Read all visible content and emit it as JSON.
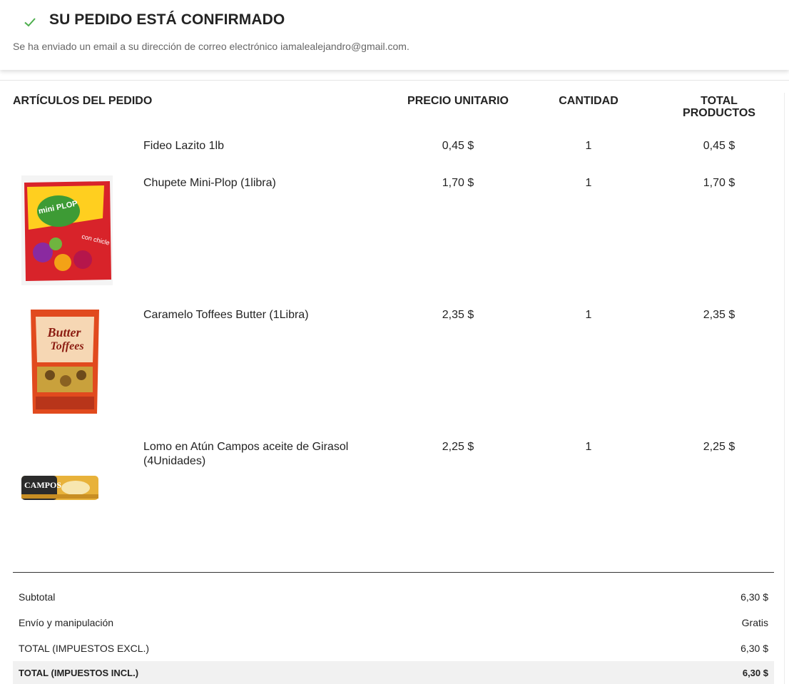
{
  "header": {
    "title": "SU PEDIDO ESTÁ CONFIRMADO",
    "subtitle": "Se ha enviado un email a su dirección de correo electrónico iamalealejandro@gmail.com.",
    "check_color": "#4cae4c"
  },
  "table": {
    "headers": {
      "items": "ARTÍCULOS DEL PEDIDO",
      "unit_price": "PRECIO UNITARIO",
      "quantity": "CANTIDAD",
      "total_line1": "TOTAL",
      "total_line2": "PRODUCTOS"
    },
    "rows": [
      {
        "name": "Fideo Lazito 1lb",
        "price": "0,45 $",
        "qty": "1",
        "total": "0,45 $"
      },
      {
        "name": "Chupete Mini-Plop (1libra)",
        "price": "1,70 $",
        "qty": "1",
        "total": "1,70 $",
        "image": "mini-plop-bag"
      },
      {
        "name": "Caramelo Toffees Butter (1Libra)",
        "price": "2,35 $",
        "qty": "1",
        "total": "2,35 $",
        "image": "butter-toffees-bag"
      },
      {
        "name": "Lomo en Atún Campos aceite de Girasol (4Unidades)",
        "price": "2,25 $",
        "qty": "1",
        "total": "2,25 $",
        "image": "campos-tuna-cans"
      }
    ]
  },
  "summary": {
    "subtotal_label": "Subtotal",
    "subtotal_value": "6,30 $",
    "shipping_label": "Envío y manipulación",
    "shipping_value": "Gratis",
    "total_excl_label": "TOTAL (IMPUESTOS EXCL.)",
    "total_excl_value": "6,30 $",
    "total_incl_label": "TOTAL (IMPUESTOS INCL.)",
    "total_incl_value": "6,30 $"
  },
  "images": {
    "mini_plop_logo": "mini PLOP",
    "mini_plop_tagline": "con chicle",
    "butter_toffees_logo_1": "Butter",
    "butter_toffees_logo_2": "Toffees",
    "campos_logo": "CAMPOS"
  }
}
